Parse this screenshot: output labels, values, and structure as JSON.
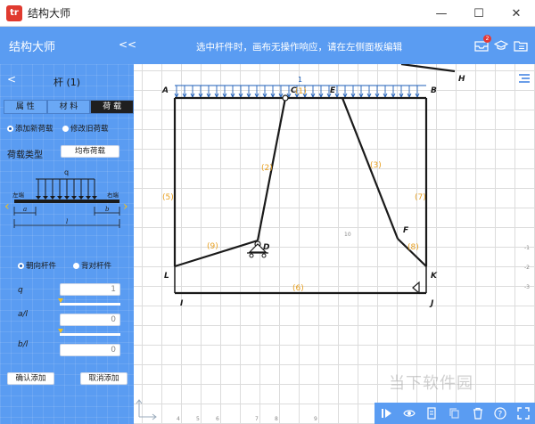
{
  "app": {
    "title": "结构大师",
    "logo_text": "tr"
  },
  "window": {
    "minimize": "—",
    "maximize": "☐",
    "close": "✕"
  },
  "header": {
    "title": "结构大师",
    "collapse": "<<",
    "message": "选中杆件时，画布无操作响应，请在左侧面板编辑",
    "badge_count": "2"
  },
  "panel": {
    "back": "<",
    "title": "杆 (1)",
    "tabs": [
      {
        "label": "属 性"
      },
      {
        "label": "材 料"
      },
      {
        "label": "荷 载"
      }
    ],
    "mode_options": [
      {
        "label": "添加新荷载",
        "checked": true
      },
      {
        "label": "修改旧荷载",
        "checked": false
      }
    ],
    "load_type_label": "荷载类型",
    "load_type_value": "均布荷载",
    "diagram_labels": {
      "q": "q",
      "left": "左端",
      "right": "右端",
      "a": "a",
      "b": "b",
      "l": "l"
    },
    "direction_options": [
      {
        "label": "朝向杆件",
        "checked": true
      },
      {
        "label": "背对杆件",
        "checked": false
      }
    ],
    "fields": [
      {
        "label": "q",
        "value": "1"
      },
      {
        "label": "a/l",
        "value": "0"
      },
      {
        "label": "b/l",
        "value": "0"
      }
    ],
    "confirm_label": "确认添加",
    "cancel_label": "取消添加"
  },
  "canvas": {
    "node_labels": [
      "A",
      "B",
      "C",
      "E",
      "D",
      "F",
      "H",
      "L",
      "K",
      "I",
      "J"
    ],
    "member_labels": [
      "(1)",
      "(2)",
      "(3)",
      "(5)",
      "(6)",
      "(7)",
      "(8)",
      "(9)"
    ],
    "load_label": "1",
    "axis_ticks": [
      "1",
      "2",
      "3",
      "4",
      "5",
      "6",
      "7",
      "8",
      "9",
      "10"
    ],
    "axis_ticks_y": [
      "-1",
      "-2",
      "-3"
    ],
    "colors": {
      "member": "#1a1a1a",
      "member_label": "#e8a020",
      "load": "#1f5fb8"
    }
  },
  "watermark": "当下软件园",
  "toolbar": {
    "icons": [
      "play-icon",
      "eye-icon",
      "document-icon",
      "copy-icon",
      "trash-icon",
      "help-icon",
      "fullscreen-icon"
    ]
  }
}
